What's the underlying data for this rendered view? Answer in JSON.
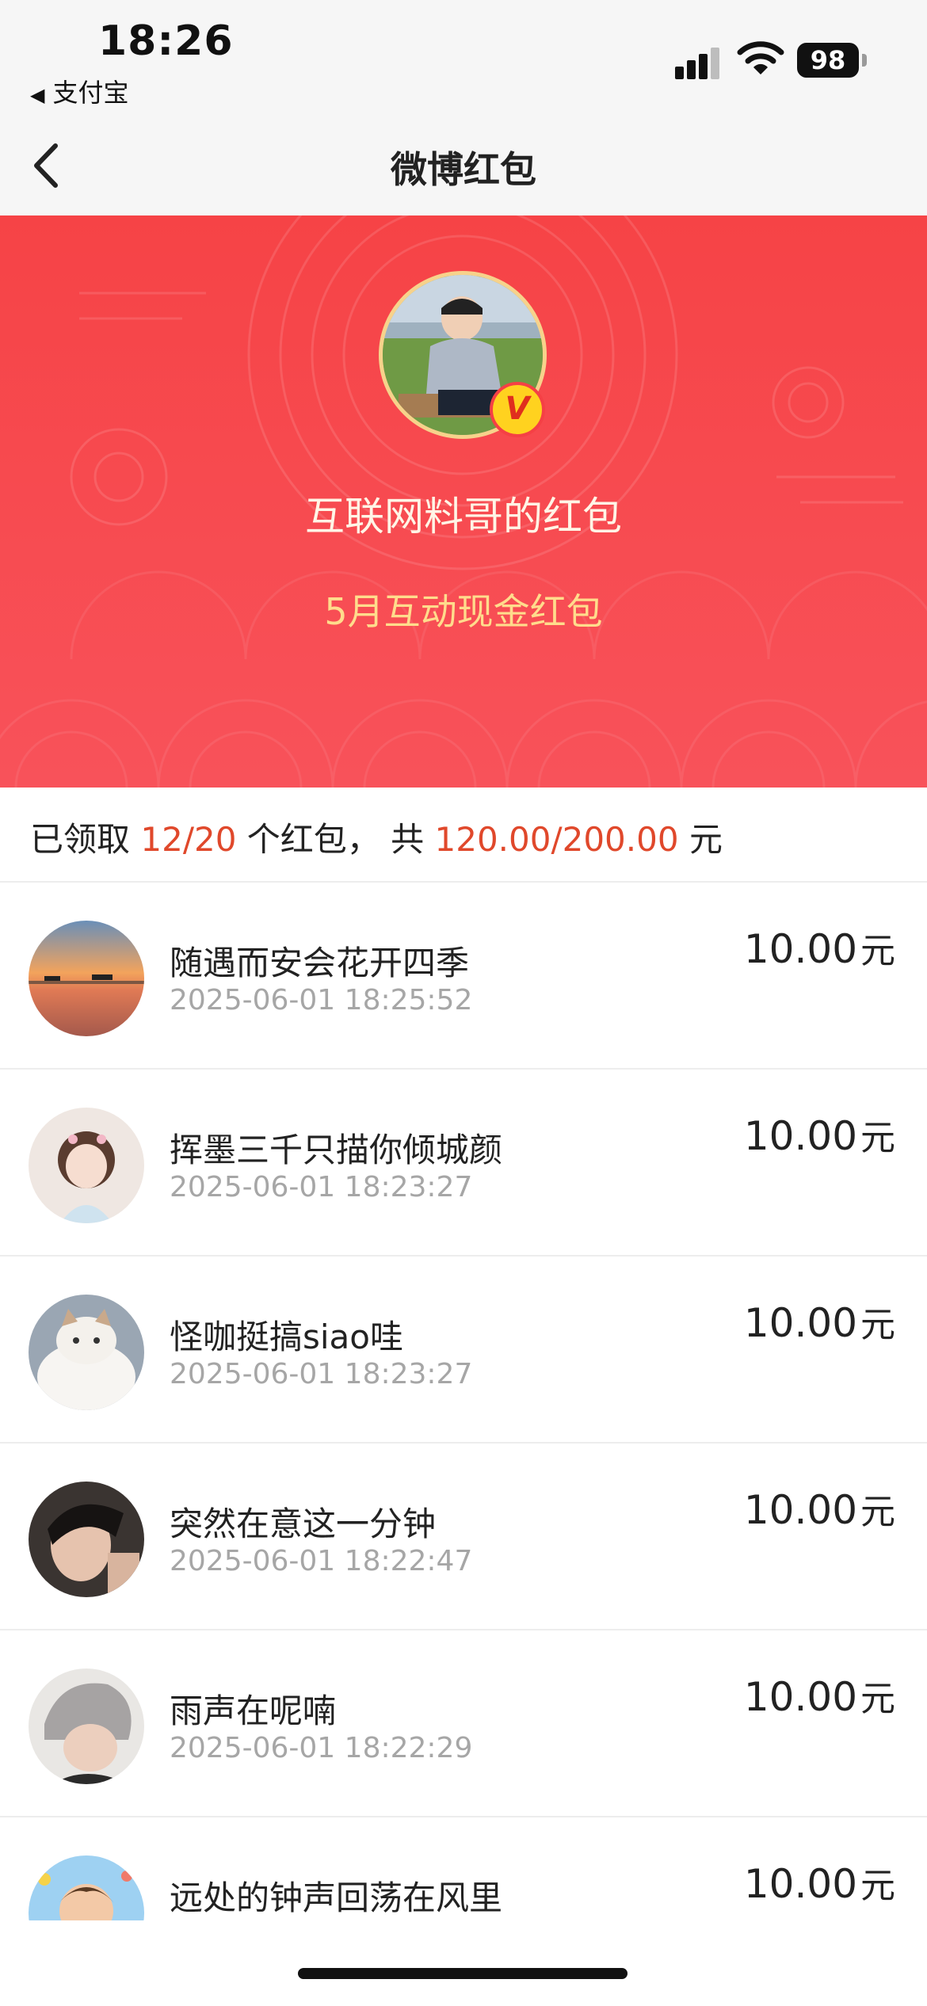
{
  "status_bar": {
    "time": "18:26",
    "back_app": "支付宝",
    "battery": "98"
  },
  "nav": {
    "title": "微博红包"
  },
  "hero": {
    "sender": "互联网料哥的红包",
    "campaign": "5月互动现金红包",
    "badge": "V",
    "colors": {
      "accent": "#f64346",
      "gold": "#ffdc8c"
    }
  },
  "summary": {
    "prefix": "已领取",
    "claimed": "12/20",
    "middle": "个红包，  共",
    "amount": "120.00/200.00",
    "suffix": "元"
  },
  "records": [
    {
      "name": "随遇而安会花开四季",
      "time": "2025-06-01 18:25:52",
      "amount": "10.00",
      "unit": "元"
    },
    {
      "name": "挥墨三千只描你倾城颜",
      "time": "2025-06-01 18:23:27",
      "amount": "10.00",
      "unit": "元"
    },
    {
      "name": "怪咖挺搞siao哇",
      "time": "2025-06-01 18:23:27",
      "amount": "10.00",
      "unit": "元"
    },
    {
      "name": "突然在意这一分钟",
      "time": "2025-06-01 18:22:47",
      "amount": "10.00",
      "unit": "元"
    },
    {
      "name": "雨声在呢喃",
      "time": "2025-06-01 18:22:29",
      "amount": "10.00",
      "unit": "元"
    },
    {
      "name": "远处的钟声回荡在风里",
      "time": "",
      "amount": "10.00",
      "unit": "元"
    }
  ]
}
